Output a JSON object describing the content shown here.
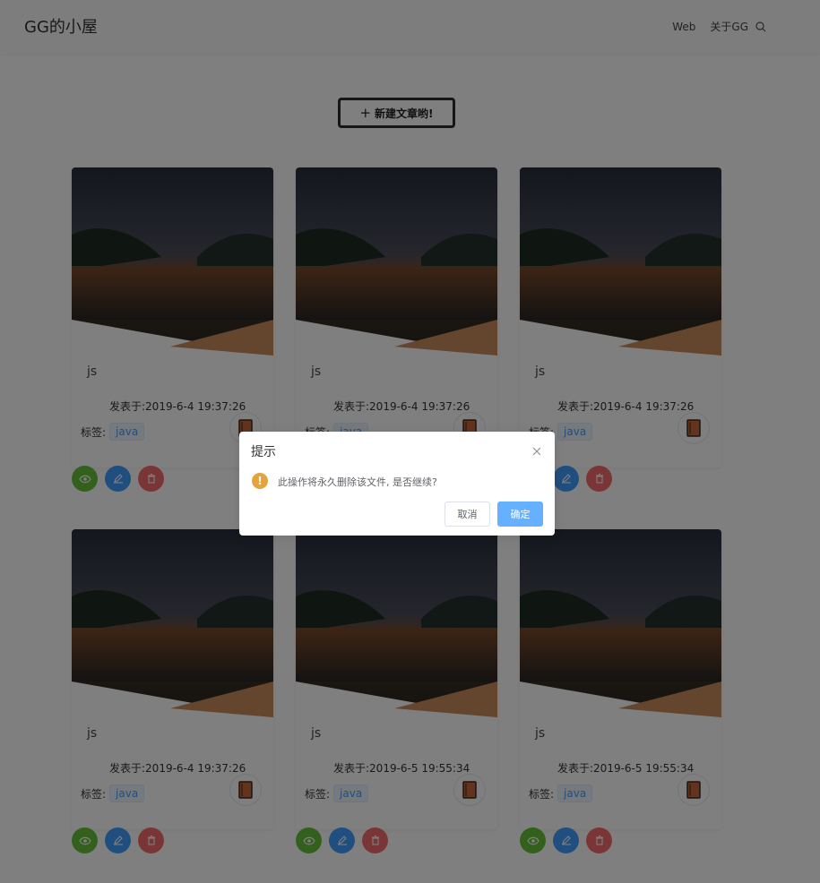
{
  "header": {
    "site_title": "GG的小屋",
    "nav": [
      {
        "label": "Web"
      },
      {
        "label": "关于GG"
      }
    ],
    "search_icon": "search-icon"
  },
  "toolbar": {
    "new_article_label": "新建文章哟!"
  },
  "cards": [
    {
      "title": "js",
      "date_prefix": "发表于:",
      "date": "2019-6-4 19:37:26",
      "tag_label": "标签:",
      "tag": "java"
    },
    {
      "title": "js",
      "date_prefix": "发表于:",
      "date": "2019-6-4 19:37:26",
      "tag_label": "标签:",
      "tag": "java"
    },
    {
      "title": "js",
      "date_prefix": "发表于:",
      "date": "2019-6-4 19:37:26",
      "tag_label": "标签:",
      "tag": "java"
    },
    {
      "title": "js",
      "date_prefix": "发表于:",
      "date": "2019-6-4 19:37:26",
      "tag_label": "标签:",
      "tag": "java"
    },
    {
      "title": "js",
      "date_prefix": "发表于:",
      "date": "2019-6-5 19:55:34",
      "tag_label": "标签:",
      "tag": "java"
    },
    {
      "title": "js",
      "date_prefix": "发表于:",
      "date": "2019-6-5 19:55:34",
      "tag_label": "标签:",
      "tag": "java"
    }
  ],
  "card_actions": [
    {
      "icon": "eye-icon",
      "color": "#67c23a"
    },
    {
      "icon": "edit-icon",
      "color": "#409eff"
    },
    {
      "icon": "trash-icon",
      "color": "#f56c6c"
    }
  ],
  "dialog": {
    "title": "提示",
    "message": "此操作将永久删除该文件, 是否继续?",
    "cancel_label": "取消",
    "confirm_label": "确定",
    "warning_icon": "warning-icon",
    "close_icon": "close-icon"
  },
  "colors": {
    "overlay": "rgba(0,0,0,0.5)",
    "primary": "#409eff",
    "success": "#67c23a",
    "danger": "#f56c6c",
    "warning": "#e6a23c"
  }
}
